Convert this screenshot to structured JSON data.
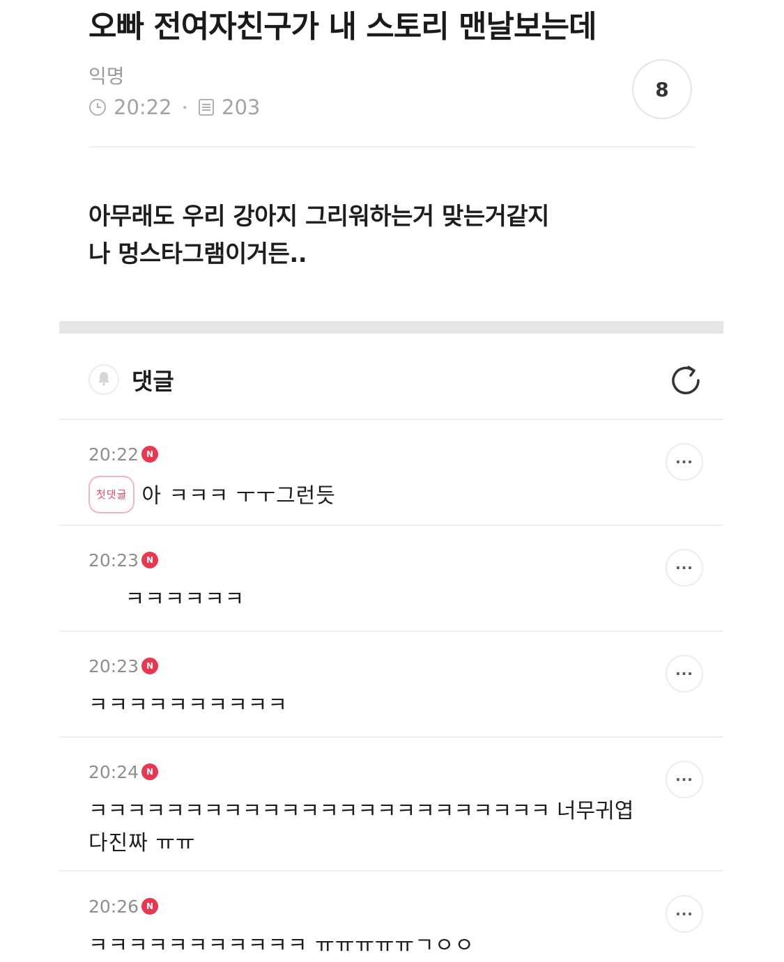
{
  "post": {
    "title": "오빠 전여자친구가 내 스토리 맨날보는데",
    "author": "익명",
    "time": "20:22",
    "views": "203",
    "comment_count": "8",
    "body_lines": [
      "아무래도 우리 강아지 그리워하는거 맞는거같지",
      "나 멍스타그램이거든.."
    ]
  },
  "comments_section": {
    "title": "댓글"
  },
  "comments": [
    {
      "time": "20:22",
      "badge": "첫댓글",
      "text": "아      ㅋㅋㅋ ㅜㅜ그런듯"
    },
    {
      "time": "20:23",
      "badge": "",
      "text": "     ㅋㅋㅋㅋㅋㅋ"
    },
    {
      "time": "20:23",
      "badge": "",
      "text": "ㅋㅋㅋㅋㅋㅋㅋㅋㅋㅋ"
    },
    {
      "time": "20:24",
      "badge": "",
      "text": "ㅋㅋㅋㅋㅋㅋㅋㅋㅋㅋㅋㅋㅋㅋㅋㅋㅋㅋㅋㅋㅋㅋㅋㅋ 너무귀엽",
      "text2": "다진짜 ㅠㅠ"
    },
    {
      "time": "20:26",
      "badge": "",
      "text": "ㅋㅋㅋㅋㅋㅋㅋㅋㅋㅋㅋ ㅠㅠㅠㅠㅠㄱㅇㅇ"
    }
  ],
  "icons": {
    "new_badge_letter": "N",
    "more_label": "···"
  },
  "colors": {
    "new_badge": "#e8384f",
    "first_badge": "#e24a62"
  }
}
